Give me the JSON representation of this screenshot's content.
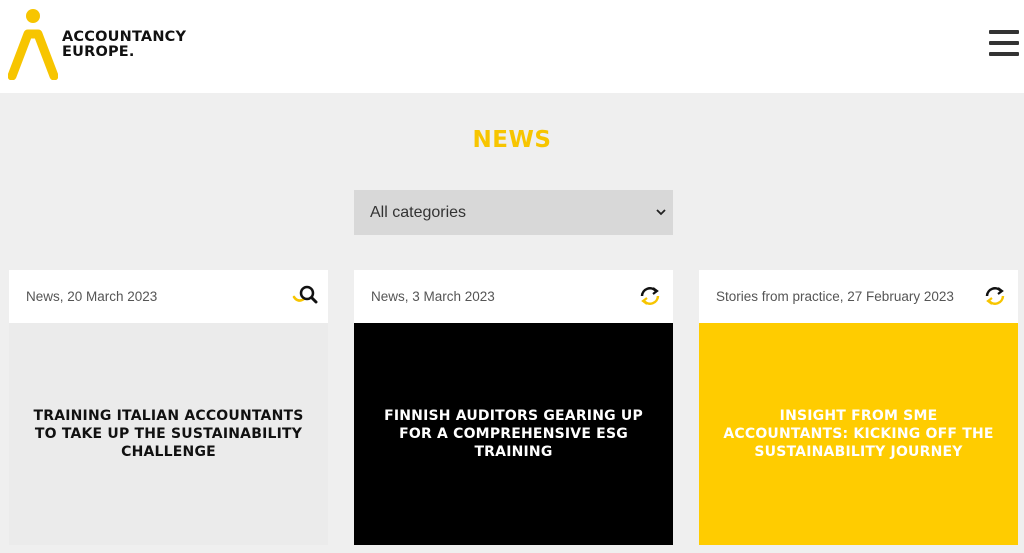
{
  "header": {
    "logo_line1": "ACCOUNTANCY",
    "logo_line2": "EUROPE."
  },
  "page": {
    "title": "NEWS"
  },
  "filter": {
    "selected": "All categories"
  },
  "colors": {
    "accent": "#f7c500",
    "card_light": "#ebebeb",
    "card_dark": "#000000",
    "card_yellow": "#ffcc00"
  },
  "cards": [
    {
      "meta": "News, 20 March 2023",
      "title": "TRAINING ITALIAN ACCOUNTANTS TO TAKE UP THE SUSTAINABILITY CHALLENGE",
      "icon": "magnifier-icon"
    },
    {
      "meta": "News, 3 March 2023",
      "title": "FINNISH AUDITORS GEARING UP FOR A COMPREHENSIVE ESG TRAINING",
      "icon": "refresh-icon"
    },
    {
      "meta": "Stories from practice, 27 February 2023",
      "title": "INSIGHT FROM SME ACCOUNTANTS: KICKING OFF THE SUSTAINABILITY JOURNEY",
      "icon": "refresh-icon"
    }
  ]
}
